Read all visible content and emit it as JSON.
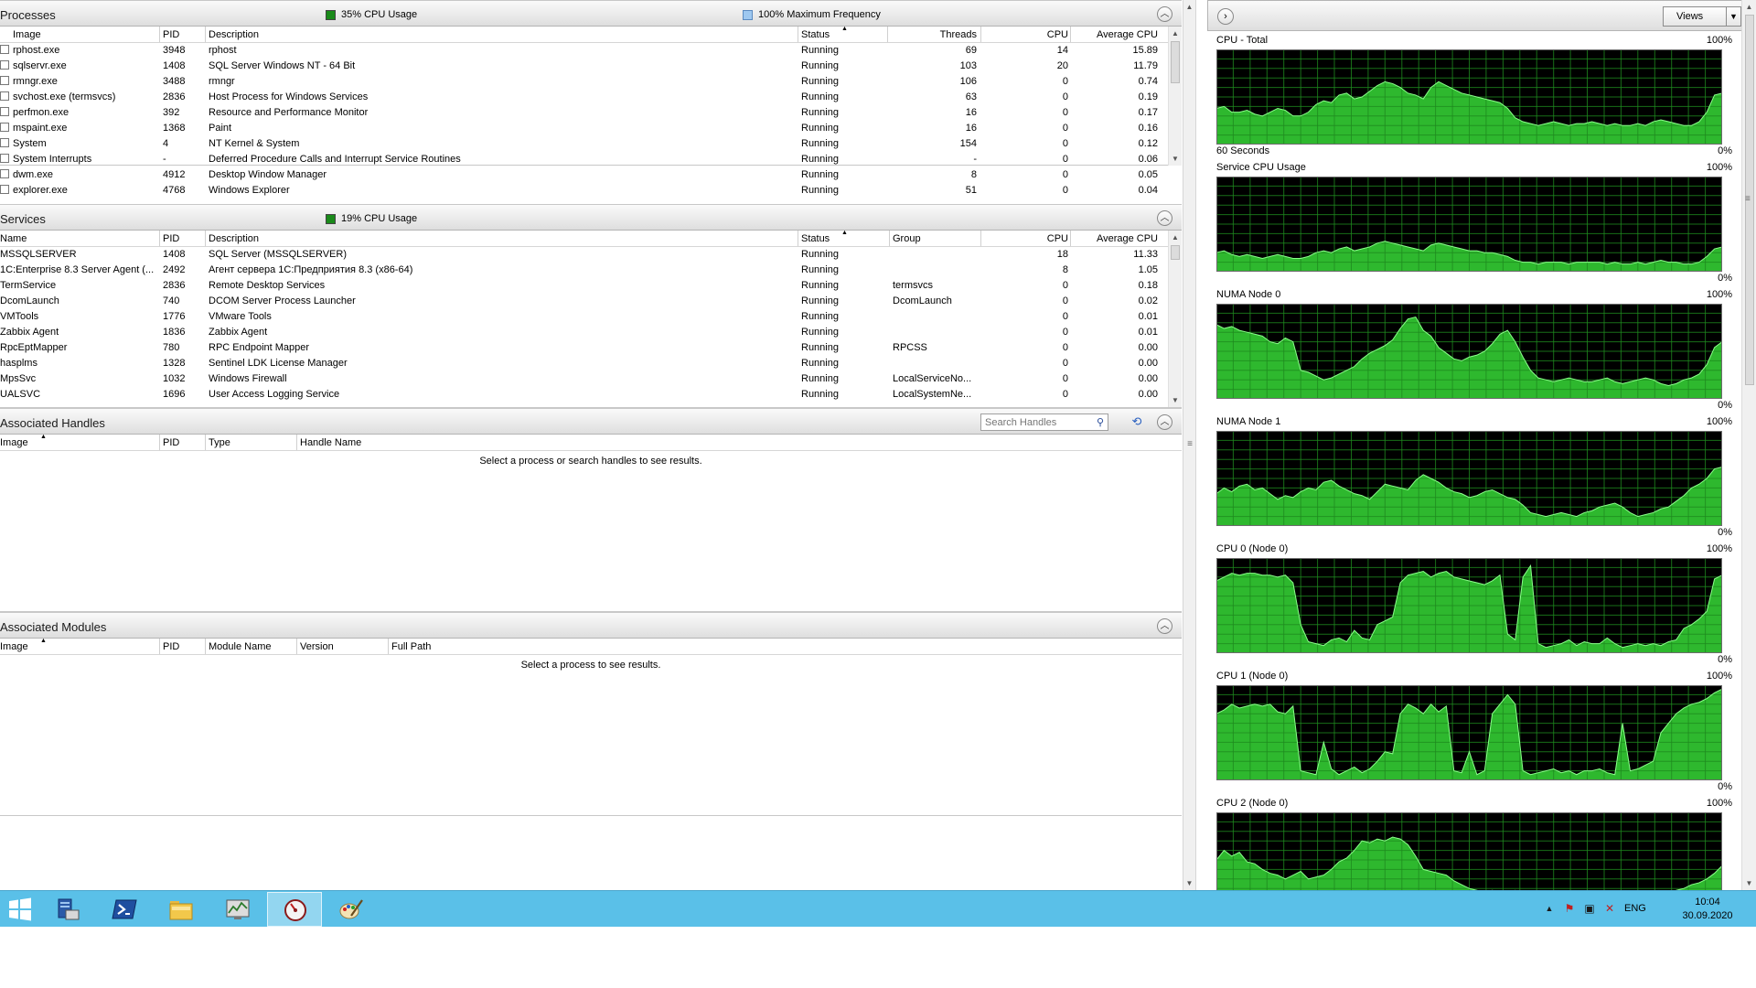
{
  "processes": {
    "title": "Processes",
    "legend_cpu": "35% CPU Usage",
    "legend_freq": "100% Maximum Frequency",
    "legend_cpu_color": "#1a8a1a",
    "legend_freq_color": "#9ec8f0",
    "columns": [
      "Image",
      "PID",
      "Description",
      "Status",
      "Threads",
      "CPU",
      "Average CPU"
    ],
    "rows": [
      [
        "rphost.exe",
        "3948",
        "rphost",
        "Running",
        "69",
        "14",
        "15.89"
      ],
      [
        "sqlservr.exe",
        "1408",
        "SQL Server Windows NT - 64 Bit",
        "Running",
        "103",
        "20",
        "11.79"
      ],
      [
        "rmngr.exe",
        "3488",
        "rmngr",
        "Running",
        "106",
        "0",
        "0.74"
      ],
      [
        "svchost.exe (termsvcs)",
        "2836",
        "Host Process for Windows Services",
        "Running",
        "63",
        "0",
        "0.19"
      ],
      [
        "perfmon.exe",
        "392",
        "Resource and Performance Monitor",
        "Running",
        "16",
        "0",
        "0.17"
      ],
      [
        "mspaint.exe",
        "1368",
        "Paint",
        "Running",
        "16",
        "0",
        "0.16"
      ],
      [
        "System",
        "4",
        "NT Kernel & System",
        "Running",
        "154",
        "0",
        "0.12"
      ],
      [
        "System Interrupts",
        "-",
        "Deferred Procedure Calls and Interrupt Service Routines",
        "Running",
        "-",
        "0",
        "0.06"
      ],
      [
        "dwm.exe",
        "4912",
        "Desktop Window Manager",
        "Running",
        "8",
        "0",
        "0.05"
      ],
      [
        "explorer.exe",
        "4768",
        "Windows Explorer",
        "Running",
        "51",
        "0",
        "0.04"
      ]
    ]
  },
  "services": {
    "title": "Services",
    "legend_cpu": "19% CPU Usage",
    "columns": [
      "Name",
      "PID",
      "Description",
      "Status",
      "Group",
      "CPU",
      "Average CPU"
    ],
    "rows": [
      [
        "MSSQLSERVER",
        "1408",
        "SQL Server (MSSQLSERVER)",
        "Running",
        "",
        "18",
        "11.33"
      ],
      [
        "1C:Enterprise 8.3 Server Agent (...",
        "2492",
        "Агент сервера 1С:Предприятия 8.3 (x86-64)",
        "Running",
        "",
        "8",
        "1.05"
      ],
      [
        "TermService",
        "2836",
        "Remote Desktop Services",
        "Running",
        "termsvcs",
        "0",
        "0.18"
      ],
      [
        "DcomLaunch",
        "740",
        "DCOM Server Process Launcher",
        "Running",
        "DcomLaunch",
        "0",
        "0.02"
      ],
      [
        "VMTools",
        "1776",
        "VMware Tools",
        "Running",
        "",
        "0",
        "0.01"
      ],
      [
        "Zabbix Agent",
        "1836",
        "Zabbix Agent",
        "Running",
        "",
        "0",
        "0.01"
      ],
      [
        "RpcEptMapper",
        "780",
        "RPC Endpoint Mapper",
        "Running",
        "RPCSS",
        "0",
        "0.00"
      ],
      [
        "hasplms",
        "1328",
        "Sentinel LDK License Manager",
        "Running",
        "",
        "0",
        "0.00"
      ],
      [
        "MpsSvc",
        "1032",
        "Windows Firewall",
        "Running",
        "LocalServiceNo...",
        "0",
        "0.00"
      ],
      [
        "UALSVC",
        "1696",
        "User Access Logging Service",
        "Running",
        "LocalSystemNe...",
        "0",
        "0.00"
      ]
    ]
  },
  "handles": {
    "title": "Associated Handles",
    "search_placeholder": "Search Handles",
    "columns": [
      "Image",
      "PID",
      "Type",
      "Handle Name"
    ],
    "empty_message": "Select a process or search handles to see results."
  },
  "modules": {
    "title": "Associated Modules",
    "columns": [
      "Image",
      "PID",
      "Module Name",
      "Version",
      "Full Path"
    ],
    "empty_message": "Select a process to see results."
  },
  "graph_panel": {
    "views_label": "Views",
    "graph_bg": "#000000",
    "graph_grid": "#1f8a1f",
    "graph_fill": "#2eb82e",
    "graph_line": "#8aff8a",
    "graphs": [
      {
        "title": "CPU - Total",
        "max": "100%",
        "min": "0%",
        "footer": "60 Seconds",
        "values": [
          38,
          40,
          34,
          34,
          36,
          32,
          30,
          34,
          38,
          36,
          30,
          30,
          34,
          42,
          46,
          44,
          52,
          54,
          48,
          50,
          56,
          62,
          66,
          64,
          60,
          54,
          52,
          48,
          60,
          66,
          62,
          58,
          54,
          52,
          50,
          48,
          46,
          44,
          38,
          28,
          24,
          22,
          20,
          22,
          24,
          22,
          20,
          22,
          22,
          24,
          22,
          20,
          22,
          20,
          20,
          22,
          20,
          24,
          26,
          24,
          22,
          20,
          20,
          24,
          34,
          52,
          54
        ]
      },
      {
        "title": "Service CPU Usage",
        "max": "100%",
        "min": "0%",
        "footer": "",
        "values": [
          20,
          22,
          18,
          16,
          18,
          16,
          14,
          16,
          18,
          16,
          14,
          14,
          16,
          20,
          22,
          20,
          24,
          26,
          22,
          24,
          26,
          30,
          32,
          30,
          28,
          26,
          24,
          22,
          28,
          30,
          28,
          26,
          24,
          22,
          22,
          20,
          20,
          18,
          16,
          12,
          10,
          10,
          8,
          10,
          10,
          10,
          8,
          10,
          10,
          10,
          10,
          8,
          10,
          8,
          8,
          10,
          8,
          10,
          12,
          10,
          10,
          8,
          8,
          10,
          16,
          24,
          26
        ]
      },
      {
        "title": "NUMA Node 0",
        "max": "100%",
        "min": "0%",
        "footer": "",
        "values": [
          78,
          74,
          76,
          72,
          70,
          68,
          66,
          60,
          58,
          64,
          60,
          30,
          28,
          24,
          20,
          22,
          26,
          30,
          34,
          42,
          48,
          52,
          56,
          62,
          74,
          84,
          86,
          72,
          66,
          54,
          48,
          42,
          40,
          44,
          46,
          50,
          58,
          68,
          72,
          60,
          44,
          30,
          22,
          20,
          18,
          20,
          22,
          20,
          18,
          18,
          20,
          22,
          18,
          16,
          18,
          20,
          22,
          20,
          16,
          14,
          16,
          20,
          22,
          26,
          36,
          54,
          60
        ]
      },
      {
        "title": "NUMA Node 1",
        "max": "100%",
        "min": "0%",
        "footer": "",
        "values": [
          34,
          40,
          36,
          42,
          44,
          38,
          40,
          34,
          28,
          32,
          30,
          36,
          40,
          38,
          46,
          48,
          42,
          38,
          34,
          32,
          28,
          36,
          44,
          42,
          40,
          38,
          48,
          54,
          50,
          46,
          40,
          36,
          34,
          30,
          32,
          36,
          38,
          34,
          30,
          28,
          22,
          14,
          12,
          10,
          12,
          14,
          12,
          10,
          14,
          16,
          20,
          22,
          24,
          20,
          14,
          10,
          12,
          14,
          18,
          20,
          26,
          32,
          40,
          44,
          50,
          60,
          62
        ]
      },
      {
        "title": "CPU 0 (Node 0)",
        "max": "100%",
        "min": "0%",
        "footer": "",
        "values": [
          76,
          80,
          84,
          82,
          84,
          84,
          82,
          82,
          80,
          82,
          74,
          30,
          12,
          10,
          8,
          14,
          16,
          12,
          24,
          16,
          14,
          30,
          34,
          38,
          74,
          82,
          84,
          86,
          80,
          84,
          86,
          80,
          78,
          76,
          74,
          72,
          76,
          82,
          20,
          14,
          80,
          92,
          10,
          6,
          8,
          10,
          14,
          8,
          12,
          10,
          10,
          16,
          10,
          6,
          8,
          10,
          8,
          10,
          8,
          12,
          14,
          26,
          30,
          36,
          44,
          78,
          82
        ]
      },
      {
        "title": "CPU 1 (Node 0)",
        "max": "100%",
        "min": "0%",
        "footer": "",
        "values": [
          70,
          74,
          80,
          76,
          78,
          80,
          78,
          80,
          72,
          70,
          78,
          10,
          8,
          6,
          40,
          12,
          6,
          10,
          14,
          8,
          12,
          20,
          30,
          28,
          70,
          80,
          76,
          70,
          80,
          72,
          78,
          10,
          8,
          30,
          6,
          10,
          70,
          80,
          90,
          80,
          10,
          6,
          8,
          10,
          12,
          8,
          10,
          6,
          10,
          10,
          12,
          8,
          6,
          60,
          10,
          12,
          16,
          20,
          50,
          60,
          70,
          76,
          80,
          82,
          86,
          92,
          96
        ]
      },
      {
        "title": "CPU 2 (Node 0)",
        "max": "100%",
        "min": "0%",
        "footer": "",
        "values": [
          50,
          60,
          54,
          58,
          48,
          46,
          40,
          36,
          34,
          30,
          34,
          38,
          30,
          32,
          34,
          40,
          48,
          52,
          60,
          70,
          68,
          72,
          70,
          74,
          72,
          66,
          54,
          40,
          38,
          36,
          34,
          28,
          24,
          20,
          18,
          16,
          18,
          16,
          14,
          18,
          14,
          10,
          12,
          14,
          12,
          10,
          12,
          14,
          10,
          10,
          12,
          14,
          10,
          12,
          10,
          12,
          14,
          10,
          12,
          14,
          18,
          20,
          24,
          26,
          30,
          36,
          44
        ]
      }
    ]
  },
  "taskbar": {
    "lang": "ENG",
    "time": "10:04",
    "date": "30.09.2020",
    "bar_color": "#5ac0e8",
    "apps": [
      "start-windows-icon",
      "server-manager-icon",
      "powershell-icon",
      "file-explorer-icon",
      "resource-monitor-icon",
      "performance-monitor-icon",
      "paint-icon"
    ]
  }
}
